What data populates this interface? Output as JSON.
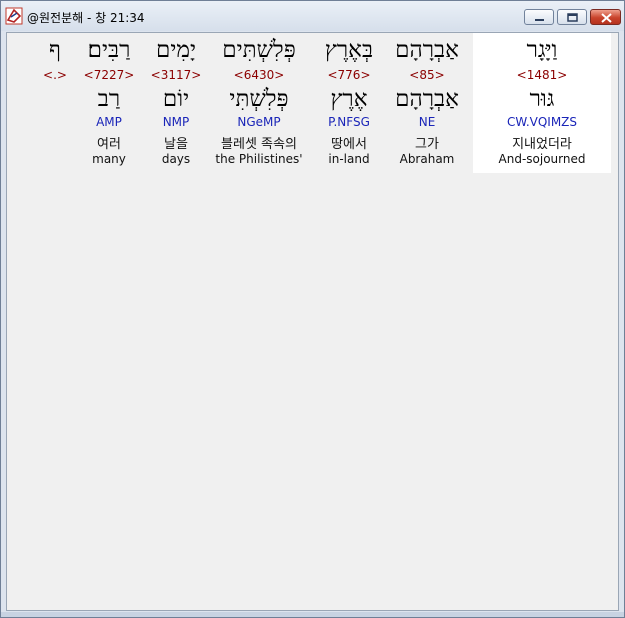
{
  "window": {
    "title": "@원전분해 - 창 21:34",
    "colors": {
      "strong": "#8b0000",
      "morph": "#1a25b8",
      "selected_bg": "#ffffff"
    }
  },
  "words": [
    {
      "id": "w1",
      "surface": "וַיָּגָר",
      "strong": "<1481>",
      "lemma": "גּוּר",
      "morph": "CW.VQIMZS",
      "korean": "지내었더라",
      "english": "And-sojourned",
      "selected": true
    },
    {
      "id": "w2",
      "surface": "אַבְרָהָם",
      "strong": "<85>",
      "lemma": "אַבְרָהָם",
      "morph": "NE",
      "korean": "그가",
      "english": "Abraham"
    },
    {
      "id": "w3",
      "surface": "בְּאֶרֶץ",
      "strong": "<776>",
      "lemma": "אֶרֶץ",
      "morph": "P.NFSG",
      "korean": "땅에서",
      "english": "in-land"
    },
    {
      "id": "w4",
      "surface": "פְּלִשְׁתִּים",
      "strong": "<6430>",
      "lemma": "פְּלִשְׁתִּי",
      "morph": "NGeMP",
      "korean": "블레셋 족속의",
      "english": "the Philistines'"
    },
    {
      "id": "w5",
      "surface": "יָמִים",
      "strong": "<3117>",
      "lemma": "יוֹם",
      "morph": "NMP",
      "korean": "날을",
      "english": "days"
    },
    {
      "id": "w6",
      "surface": "רַבִּים׃",
      "strong": "<7227>",
      "lemma": "רַב",
      "morph": "AMP",
      "korean": "여러",
      "english": "many"
    },
    {
      "id": "w7",
      "surface": "ף",
      "strong": "<.>",
      "lemma": "",
      "morph": "",
      "korean": "",
      "english": ""
    }
  ]
}
